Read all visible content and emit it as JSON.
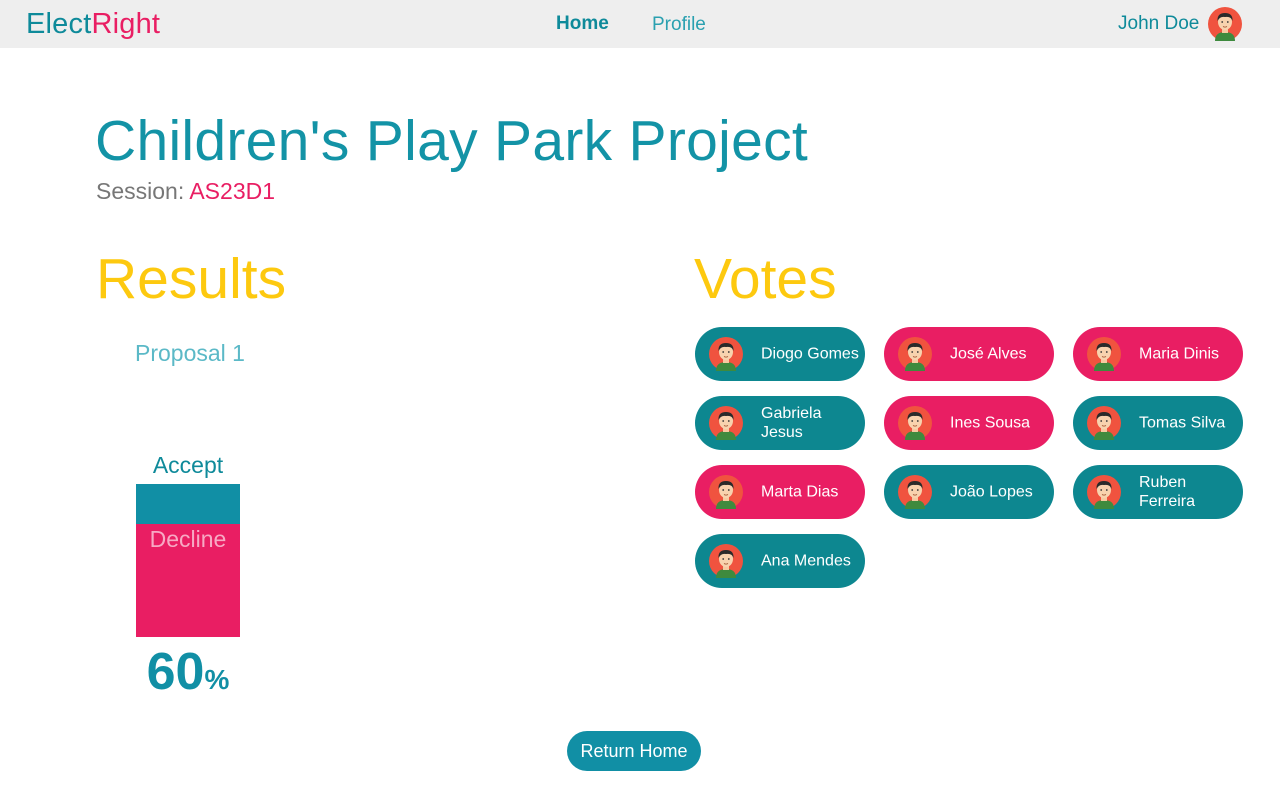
{
  "app": {
    "brand_part1": "Elect",
    "brand_part2": "Right"
  },
  "nav": {
    "home": "Home",
    "profile": "Profile"
  },
  "user": {
    "name": "John Doe"
  },
  "project": {
    "title": "Children's Play Park Project",
    "session_label": "Session: ",
    "session_code": "AS23D1"
  },
  "results": {
    "heading": "Results",
    "proposal": "Proposal 1",
    "accept_label": "Accept",
    "decline_label": "Decline",
    "accept_fraction": 0.26,
    "percent_value": "60",
    "percent_symbol": "%"
  },
  "votes": {
    "heading": "Votes",
    "voters": [
      {
        "name": "Diogo Gomes",
        "vote": "accept"
      },
      {
        "name": "José Alves",
        "vote": "decline"
      },
      {
        "name": "Maria Dinis",
        "vote": "decline"
      },
      {
        "name": "Gabriela Jesus",
        "vote": "accept"
      },
      {
        "name": "Ines Sousa",
        "vote": "decline"
      },
      {
        "name": "Tomas Silva",
        "vote": "accept"
      },
      {
        "name": "Marta Dias",
        "vote": "decline"
      },
      {
        "name": "João Lopes",
        "vote": "accept"
      },
      {
        "name": "Ruben Ferreira",
        "vote": "accept"
      },
      {
        "name": "Ana Mendes",
        "vote": "accept"
      }
    ]
  },
  "footer": {
    "return_home": "Return Home"
  },
  "colors": {
    "teal": "#0d8790",
    "pink": "#e91e63",
    "yellow": "#fdc90f",
    "nav_bg": "#eeeeee"
  },
  "icons": {
    "avatar": "user-avatar-icon"
  }
}
